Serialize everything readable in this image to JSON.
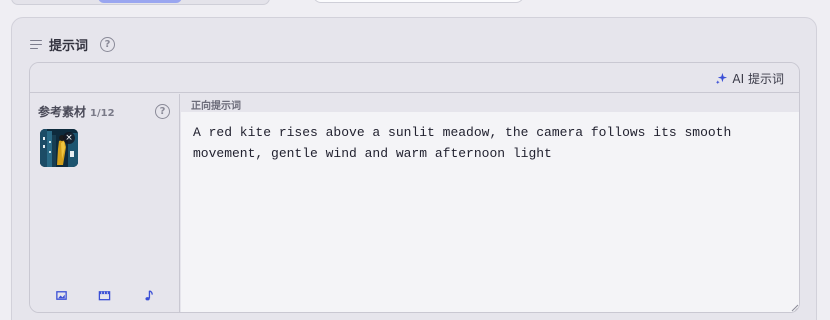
{
  "prompt_section": {
    "title": "提示词",
    "help_symbol": "?"
  },
  "toolbar": {
    "ai_prompt_label": "AI 提示词"
  },
  "reference": {
    "title": "参考素材",
    "count": "1/12",
    "help_symbol": "?",
    "thumbnail_close": "×"
  },
  "positive_prompt": {
    "label": "正向提示词",
    "value": "A red kite rises above a sunlit meadow, the camera follows its smooth movement, gentle wind and warm afternoon light"
  },
  "icons": {
    "header": "menu-lines-icon",
    "ai": "sparkle-icon",
    "tools": [
      "image-icon",
      "video-icon",
      "music-icon"
    ]
  },
  "colors": {
    "accent": "#3b4fd6",
    "segment_active": "#9aa6f0"
  }
}
